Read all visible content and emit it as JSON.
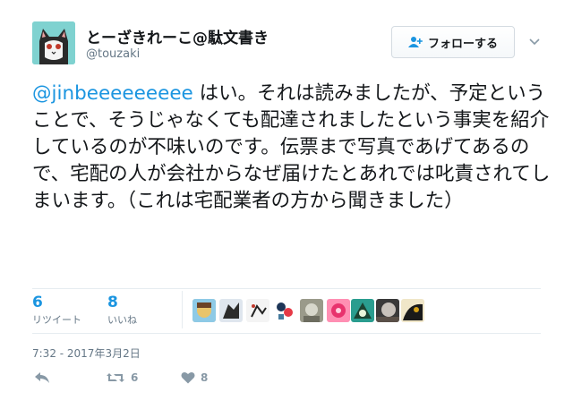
{
  "user": {
    "display_name": "とーざきれーこ@駄文書き",
    "screen_name": "@touzaki"
  },
  "follow_button": {
    "label": "フォローする"
  },
  "tweet": {
    "mention": "@jinbeeeeeeeee",
    "text": " はい。それは読みましたが、予定ということで、そうじゃなくても配達されましたという事実を紹介しているのが不味いのです。伝票まで写真であげてあるので、宅配の人が会社からなぜ届けたとあれでは叱責されてしまいます。（これは宅配業者の方から聞きました）"
  },
  "stats": {
    "retweets": {
      "count": "6",
      "label": "リツイート"
    },
    "likes": {
      "count": "8",
      "label": "いいね"
    }
  },
  "timestamp": "7:32 - 2017年3月2日",
  "actions": {
    "retweet_count": "6",
    "like_count": "8"
  },
  "colors": {
    "accent": "#1b95e0",
    "secondary_text": "#657786",
    "action_icon": "#8899a6"
  }
}
